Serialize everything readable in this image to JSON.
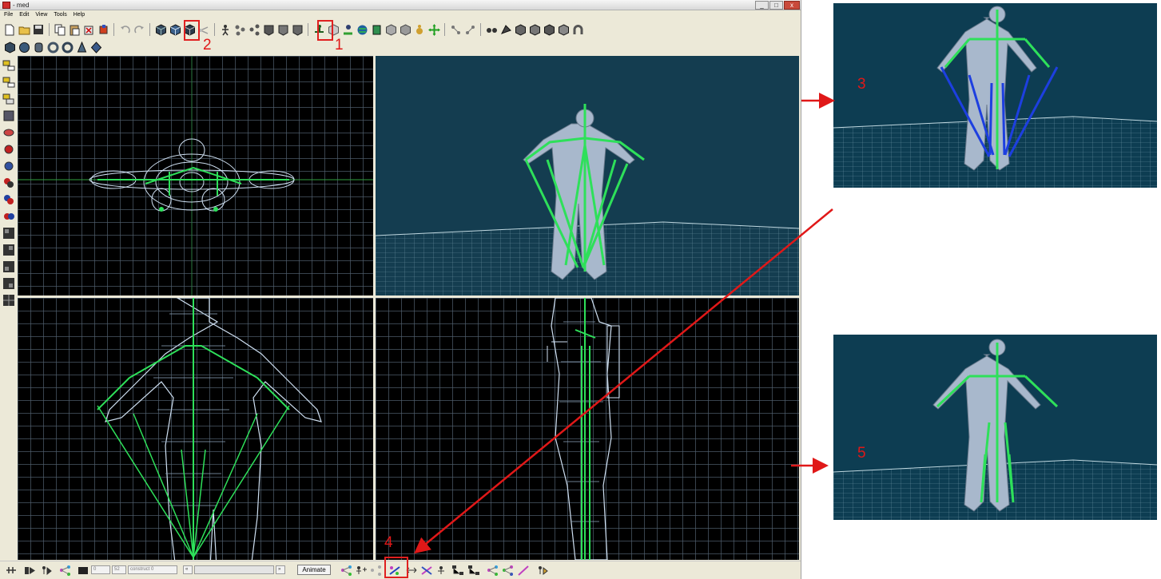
{
  "window": {
    "title": "- med",
    "min": "_",
    "max": "□",
    "close": "x"
  },
  "menu": [
    "File",
    "Edit",
    "View",
    "Tools",
    "Help"
  ],
  "annotations": {
    "label1": "1",
    "label2": "2",
    "label3": "3",
    "label4": "4",
    "label5": "5"
  },
  "bottom": {
    "frame": "0",
    "total": "52",
    "sequence": "construct 0",
    "step_back": "«",
    "step_fwd": "»",
    "animate": "Animate"
  },
  "colors": {
    "grid_bg": "#000000",
    "persp_bg": "#143d50",
    "bone": "#2ee05a",
    "bone_selected": "#1d3fe0",
    "annotation": "#e01818",
    "mesh": "#cfe0f2"
  },
  "icons": {
    "toolbar1": [
      "new-file-icon",
      "open-folder-icon",
      "save-icon",
      "copy-icon",
      "paste-icon",
      "delete-icon",
      "brush-icon",
      "undo-icon",
      "redo-icon",
      "cube-icon",
      "cube-icon",
      "cube-icon",
      "bone-link-icon",
      "figure-icon",
      "nodes-icon",
      "nodes-icon",
      "shape-icon",
      "shape-icon",
      "shape-icon",
      "figure-move-icon",
      "cube-select-icon",
      "figure-pose-icon",
      "globe-icon",
      "cylinder-icon",
      "rotate-icon",
      "figure-small-icon",
      "move-arrows-icon",
      "link-icon",
      "chain-icon",
      "glasses-icon",
      "shape-icon",
      "cube-icon",
      "cube-icon",
      "cube-icon",
      "magnet-icon"
    ],
    "toolbar2": [
      "cube-icon",
      "sphere-icon",
      "cylinder-icon",
      "torus-icon",
      "torus-icon",
      "cone-icon",
      "diamond-icon"
    ]
  }
}
